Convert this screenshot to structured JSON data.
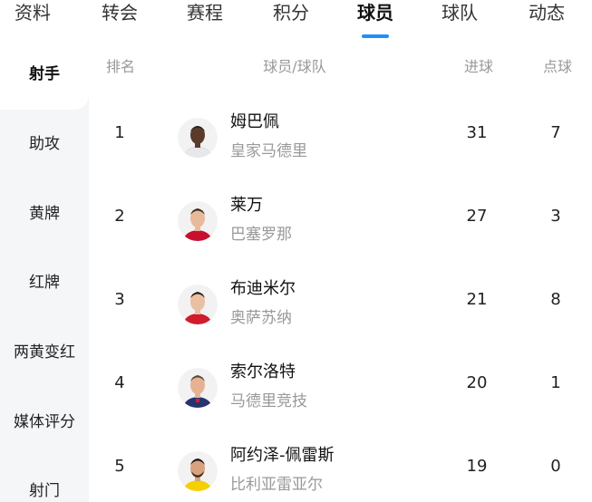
{
  "tabs": [
    "资料",
    "转会",
    "赛程",
    "积分",
    "球员",
    "球队",
    "动态"
  ],
  "active_tab": "球员",
  "accent_color": "#1e90ff",
  "sidebar": {
    "items": [
      "射手",
      "助攻",
      "黄牌",
      "红牌",
      "两黄变红",
      "媒体评分",
      "射门"
    ],
    "active": "射手"
  },
  "table": {
    "headers": {
      "rank": "排名",
      "player": "球员/球队",
      "goals": "进球",
      "penalties": "点球"
    },
    "rows": [
      {
        "rank": "1",
        "name": "姆巴佩",
        "team": "皇家马德里",
        "goals": "31",
        "penalties": "7",
        "kit_color": "#e8e8ea"
      },
      {
        "rank": "2",
        "name": "莱万",
        "team": "巴塞罗那",
        "goals": "27",
        "penalties": "3",
        "kit_color": "#c8102e"
      },
      {
        "rank": "3",
        "name": "布迪米尔",
        "team": "奥萨苏纳",
        "goals": "21",
        "penalties": "8",
        "kit_color": "#d01c2b"
      },
      {
        "rank": "4",
        "name": "索尔洛特",
        "team": "马德里竞技",
        "goals": "20",
        "penalties": "1",
        "kit_color": "#27346e"
      },
      {
        "rank": "5",
        "name": "阿约泽-佩雷斯",
        "team": "比利亚雷亚尔",
        "goals": "19",
        "penalties": "0",
        "kit_color": "#f5d000"
      }
    ]
  }
}
